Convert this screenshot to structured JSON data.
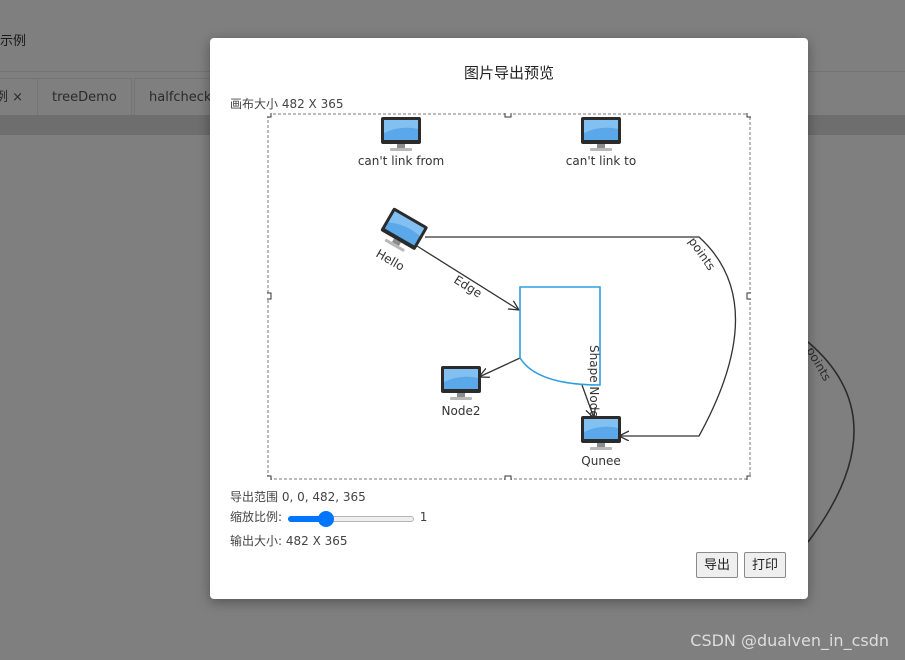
{
  "app": {
    "header_title": "示例",
    "tabs": [
      {
        "label": "例 ×"
      },
      {
        "label": "treeDemo"
      },
      {
        "label": "halfcheck"
      }
    ],
    "bg_edge_label": "points"
  },
  "dialog": {
    "title": "图片导出预览",
    "canvas_size": "画布大小 482 X 365",
    "export_range": "导出范围 0, 0, 482, 365",
    "scale_label": "缩放比例:",
    "scale_value": "1",
    "scale_fraction": 0.3,
    "output_size": "输出大小: 482 X 365",
    "export_button": "导出",
    "print_button": "打印"
  },
  "graph": {
    "nodes": {
      "cant_link_from": "can't link from",
      "cant_link_to": "can't link to",
      "hello": "Hello",
      "node2": "Node2",
      "qunee": "Qunee"
    },
    "edges": {
      "edge": "Edge",
      "points": "points",
      "shape_node": "Shape Node"
    },
    "colors": {
      "shape_stroke": "#2d9fe0",
      "edge_stroke": "#333333",
      "monitor_screen": "#5aa7ea"
    }
  },
  "watermark": "CSDN @dualven_in_csdn"
}
